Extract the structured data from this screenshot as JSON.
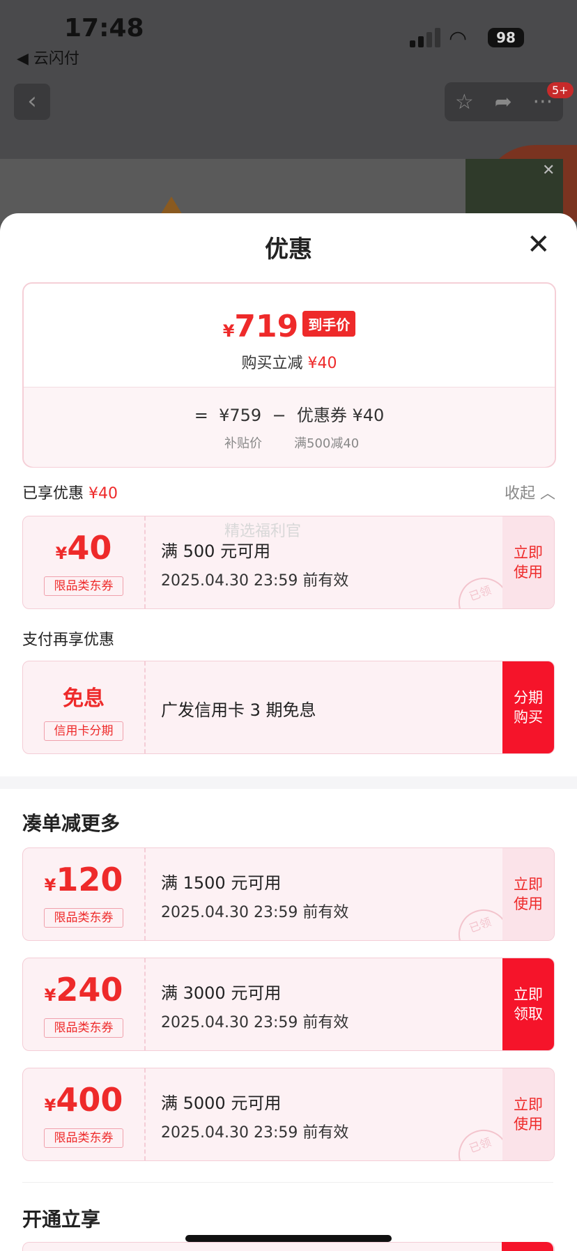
{
  "status_bar": {
    "time": "17:48",
    "back_app": "◀ 云闪付",
    "battery": "98"
  },
  "navbar": {
    "badge": "5+"
  },
  "sheet": {
    "title": "优惠",
    "summary": {
      "yen": "¥",
      "final_price": "719",
      "final_tag": "到手价",
      "sub_text": "购买立减",
      "sub_amount": "¥40",
      "formula_eq": "=",
      "formula_price": "¥759",
      "formula_minus": "−",
      "formula_coupon": "优惠券 ¥40",
      "label_subsidy": "补贴价",
      "label_coupon_rule": "满500减40"
    },
    "enjoyed": {
      "label": "已享优惠",
      "amount": "¥40",
      "collapse": "收起"
    },
    "watermark": "精选福利官",
    "pay_section": "支付再享优惠",
    "more_section": "凑单减更多",
    "open_section": "开通立享",
    "coupons": [
      {
        "yen": "¥",
        "amount": "40",
        "type": "限品类东券",
        "title": "满 500 元可用",
        "date": "2025.04.30 23:59 前有效",
        "action": "立即\n使用",
        "stamp": "已领"
      },
      {
        "amount": "免息",
        "type": "信用卡分期",
        "title": "广发信用卡 3 期免息",
        "action": "分期\n购买"
      },
      {
        "yen": "¥",
        "amount": "120",
        "type": "限品类东券",
        "title": "满 1500 元可用",
        "date": "2025.04.30 23:59 前有效",
        "action": "立即\n使用",
        "stamp": "已领"
      },
      {
        "yen": "¥",
        "amount": "240",
        "type": "限品类东券",
        "title": "满 3000 元可用",
        "date": "2025.04.30 23:59 前有效",
        "action": "立即\n领取"
      },
      {
        "yen": "¥",
        "amount": "400",
        "type": "限品类东券",
        "title": "满 5000 元可用",
        "date": "2025.04.30 23:59 前有效",
        "action": "立即\n使用",
        "stamp": "已领"
      }
    ]
  },
  "colors": {
    "accent": "#ee2a2a",
    "card_bg": "#fdf1f4",
    "action_solid": "#f5142a"
  }
}
